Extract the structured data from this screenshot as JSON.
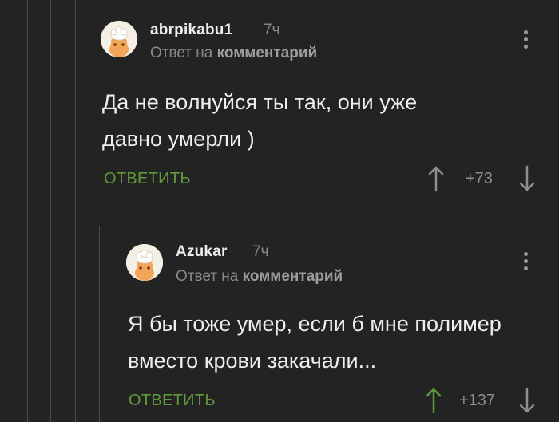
{
  "comments": [
    {
      "username": "abrpikabu1",
      "time": "7ч",
      "reply_prefix": "Ответ на",
      "reply_link": "комментарий",
      "text": "Да не волнуйся ты так, они уже давно умерли )",
      "reply_label": "ОТВЕТИТЬ",
      "rating": "+73",
      "vote": "none"
    },
    {
      "username": "Azukar",
      "time": "7ч",
      "reply_prefix": "Ответ на",
      "reply_link": "комментарий",
      "text": "Я бы тоже умер, если б мне полимер вместо крови закачали...",
      "reply_label": "ОТВЕТИТЬ",
      "rating": "+137",
      "vote": "up"
    }
  ],
  "colors": {
    "background": "#232323",
    "accent_green": "#5f9a3a",
    "muted": "#8a8a8a",
    "thread_line": "#4a4a4a"
  }
}
